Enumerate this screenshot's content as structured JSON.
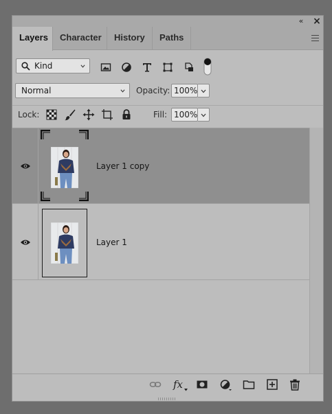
{
  "tabs": [
    {
      "label": "Layers",
      "active": true
    },
    {
      "label": "Character",
      "active": false
    },
    {
      "label": "History",
      "active": false
    },
    {
      "label": "Paths",
      "active": false
    }
  ],
  "titlebar": {
    "collapse_glyph": "«",
    "close_glyph": "×"
  },
  "filter": {
    "kind_label": "Kind",
    "icons": [
      "image-filter-icon",
      "adjustment-filter-icon",
      "type-filter-icon",
      "shape-filter-icon",
      "smart-object-filter-icon",
      "filter-toggle-icon"
    ]
  },
  "blend": {
    "mode": "Normal",
    "opacity_label": "Opacity:",
    "opacity_value": "100%"
  },
  "lock": {
    "label": "Lock:",
    "icons": [
      "lock-transparent-icon",
      "lock-pixels-icon",
      "lock-position-icon",
      "lock-artboard-icon",
      "lock-all-icon"
    ],
    "fill_label": "Fill:",
    "fill_value": "100%"
  },
  "layers": [
    {
      "name": "Layer 1 copy",
      "selected": true,
      "visible": true
    },
    {
      "name": "Layer 1",
      "selected": false,
      "visible": true
    }
  ],
  "bottom_icons": [
    "link-layers-icon",
    "fx-icon",
    "add-mask-icon",
    "new-adjustment-icon",
    "new-group-icon",
    "new-layer-icon",
    "delete-layer-icon"
  ],
  "bottom_fx_label": "fx",
  "colors": {
    "panel": "#bdbdbd",
    "selected_row": "#8f8f8f",
    "tab_bar": "#a9a9a9"
  }
}
